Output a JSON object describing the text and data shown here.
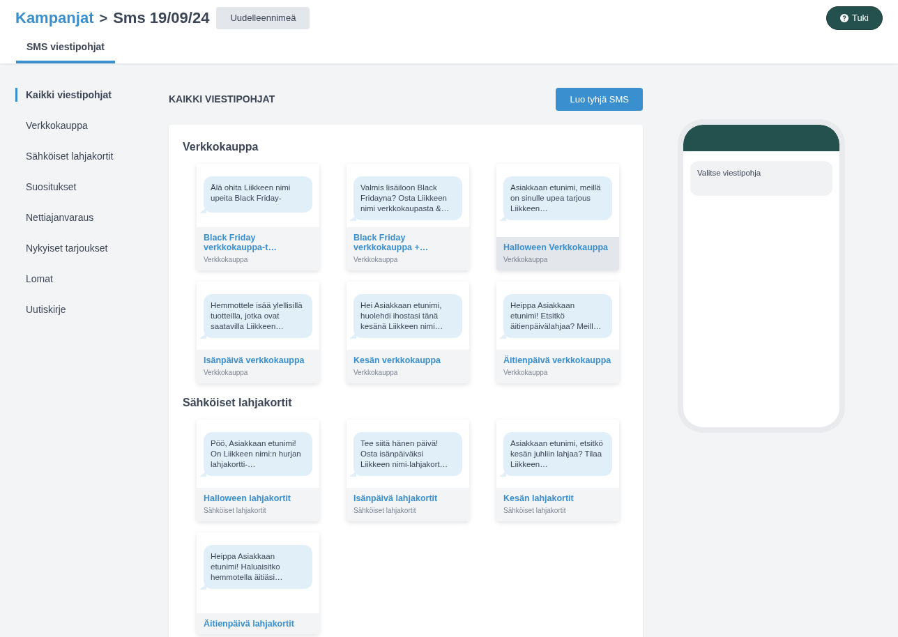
{
  "breadcrumb": {
    "parent": "Kampanjat",
    "separator": ">",
    "current": "Sms 19/09/24"
  },
  "rename_button": "Uudelleennimeä",
  "help_button": "Tuki",
  "tabs": [
    {
      "label": "SMS viestipohjat",
      "selected": true
    }
  ],
  "sidebar": {
    "items": [
      {
        "label": "Kaikki viestipohjat",
        "selected": true
      },
      {
        "label": "Verkkokauppa",
        "selected": false
      },
      {
        "label": "Sähköiset lahjakortit",
        "selected": false
      },
      {
        "label": "Suositukset",
        "selected": false
      },
      {
        "label": "Nettiajanvaraus",
        "selected": false
      },
      {
        "label": "Nykyiset tarjoukset",
        "selected": false
      },
      {
        "label": "Lomat",
        "selected": false
      },
      {
        "label": "Uutiskirje",
        "selected": false
      }
    ]
  },
  "main": {
    "title": "KAIKKI VIESTIPOHJAT",
    "create_button": "Luo tyhjä SMS",
    "sections": [
      {
        "title": "Verkkokauppa",
        "templates": [
          {
            "preview": "Älä ohita Liikkeen nimi upeita Black Friday-",
            "name": "Black Friday verkkokauppa-t…",
            "category": "Verkkokauppa",
            "selected": false
          },
          {
            "preview": "Valmis lisäiloon Black Fridayna? Osta Liikkeen nimi verkkokaupasta &…",
            "name": "Black Friday verkkokauppa +…",
            "category": "Verkkokauppa",
            "selected": false
          },
          {
            "preview": "Asiakkaan etunimi, meillä on sinulle upea tarjous Liikkeen…",
            "name": "Halloween Verkkokauppa",
            "category": "Verkkokauppa",
            "selected": true
          },
          {
            "preview": "Hemmottele isää ylellisillä tuotteilla, jotka ovat saatavilla Liikkeen…",
            "name": "Isänpäivä verkkokauppa",
            "category": "Verkkokauppa",
            "selected": false
          },
          {
            "preview": "Hei Asiakkaan etunimi, huolehdi ihostasi tänä kesänä Liikkeen nimi…",
            "name": "Kesän verkkokauppa",
            "category": "Verkkokauppa",
            "selected": false
          },
          {
            "preview": "Heippa Asiakkaan etunimi! Etsitkö äitienpäivälahjaa? Meill…",
            "name": "Äitienpäivä verkkokauppa",
            "category": "Verkkokauppa",
            "selected": false
          }
        ]
      },
      {
        "title": "Sähköiset lahjakortit",
        "templates": [
          {
            "preview": "Pöö, Asiakkaan etunimi! On Liikkeen nimi:n hurjan lahjakortti-…",
            "name": "Halloween lahjakortit",
            "category": "Sähköiset lahjakortit",
            "selected": false
          },
          {
            "preview": "Tee siitä hänen päivä! Osta isänpäiväksi Liikkeen nimi-lahjakort…",
            "name": "Isänpäivä lahjakortit",
            "category": "Sähköiset lahjakortit",
            "selected": false
          },
          {
            "preview": "Asiakkaan etunimi, etsitkö kesän juhliin lahjaa? Tilaa Liikkeen…",
            "name": "Kesän lahjakortit",
            "category": "Sähköiset lahjakortit",
            "selected": false
          },
          {
            "preview": "Heippa Asiakkaan etunimi!  Haluaisitko hemmotella äitiäsi…",
            "name": "Äitienpäivä lahjakortit",
            "selected": false
          }
        ]
      }
    ]
  },
  "phone_preview": {
    "message": "Valitse viestipohja"
  }
}
